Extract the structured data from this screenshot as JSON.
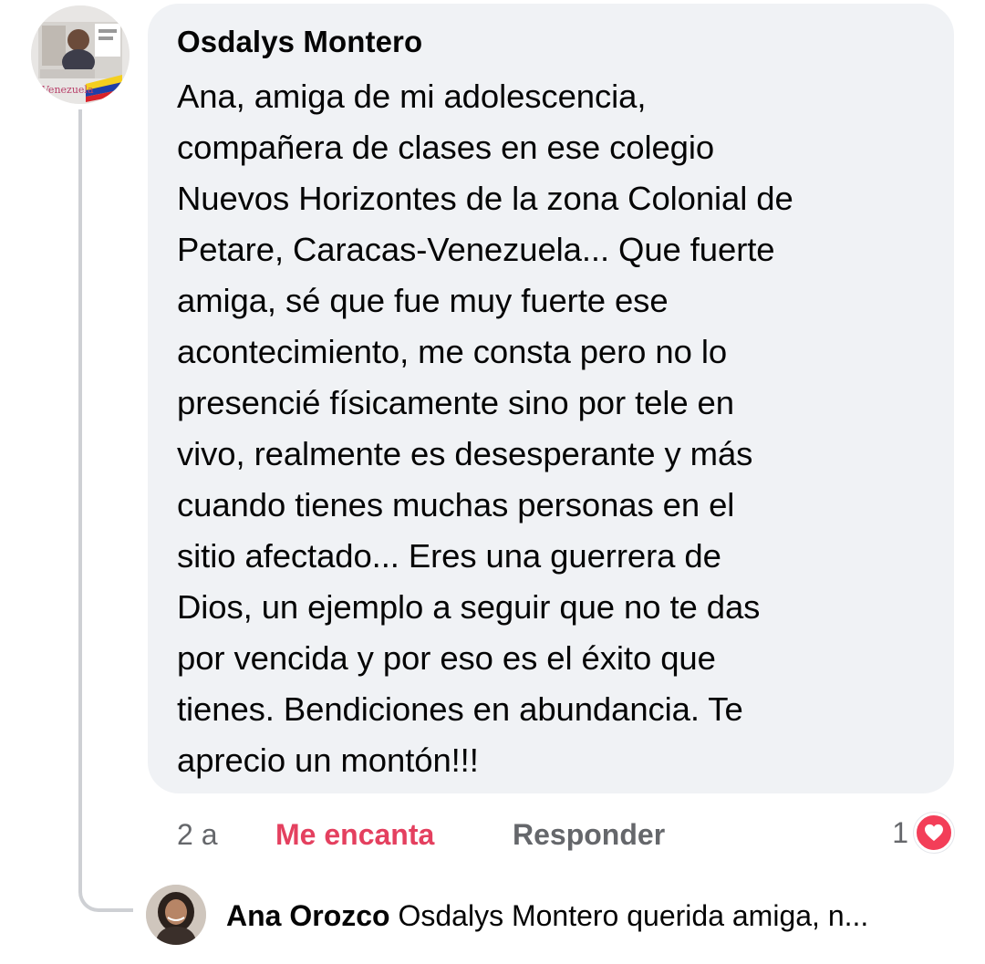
{
  "comment": {
    "author": "Osdalys Montero",
    "text": "Ana, amiga de mi adolescencia,\ncompañera de clases en ese colegio\nNuevos Horizontes de la zona Colonial de\nPetare, Caracas-Venezuela... Que fuerte\namiga, sé que fue muy fuerte ese\nacontecimiento, me consta pero no lo\npresencié físicamente sino por tele en\nvivo, realmente es desesperante y más\ncuando tienes muchas personas en el\nsitio afectado... Eres una guerrera de\nDios, un ejemplo a seguir que no te das\npor vencida y por eso es el éxito que\ntienes. Bendiciones en abundancia. Te\naprecio un montón!!!",
    "avatar_icon": "profile-photo-icon"
  },
  "actions": {
    "time": "2 a",
    "love_label": "Me encanta",
    "reply_label": "Responder"
  },
  "reactions": {
    "count": "1",
    "icon": "heart-icon",
    "color": "#f33e58"
  },
  "reply": {
    "author": "Ana Orozco",
    "preview": "Osdalys Montero querida amiga, n..."
  },
  "colors": {
    "bubble_bg": "#f0f2f5",
    "love_accent": "#e4405f",
    "muted_text": "#65676b",
    "thread_line": "#ced0d4"
  }
}
